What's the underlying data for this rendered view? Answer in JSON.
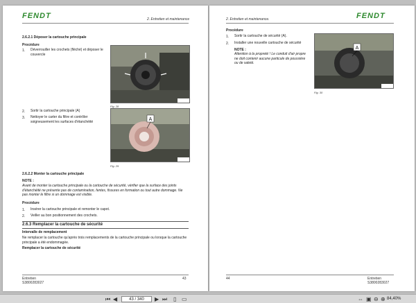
{
  "left_page": {
    "logo": "FENDT",
    "header": "2. Entretien et maintenance",
    "s1_title": "2.6.2.1  Déposer la cartouche principale",
    "procedure": "Procédure",
    "steps1": [
      {
        "n": "1.",
        "t": "Déverrouiller les crochets (fléché) et déposer le couvercle"
      },
      {
        "n": "2.",
        "t": "Sortir la cartouche principale (A)"
      },
      {
        "n": "3.",
        "t": "Nettoyer le carter du filtre et contrôler soigneusement les surfaces d'étanchéité"
      }
    ],
    "fig28": "Fig. 28",
    "fig29": "Fig. 29",
    "photo_label_a": "A",
    "s2_title": "2.6.2.2  Monter la cartouche principale",
    "note_label": "NOTE :",
    "note_text": "Avant de monter la cartouche principale ou la cartouche de sécurité, vérifier que la surface des joints d'étanchéité ne présente pas de contamination, fentes, fissures en formation ou tout autre dommage. Ne pas monter le filtre si un dommage est visible.",
    "procedure2": "Procédure",
    "steps2": [
      {
        "n": "1.",
        "t": "Insérer la cartouche principale et remonter le capot."
      },
      {
        "n": "2.",
        "t": "Veiller au bon positionnement des crochets."
      }
    ],
    "s3_title": "2.6.3  Remplacer la cartouche de sécurité",
    "interval_title": "Intervalle de remplacement",
    "interval_text": "Ne remplacer la cartouche qu'après trois remplacements de la cartouche principale ou lorsque la cartouche principale a été endommagée.",
    "replace_title": "Remplacer la cartouche de sécurité",
    "footer_left1": "Entretien",
    "footer_left2": "S3800283027",
    "page_number": "43"
  },
  "right_page": {
    "logo": "FENDT",
    "header": "2. Entretien et maintenance.",
    "procedure": "Procédure",
    "steps": [
      {
        "n": "1.",
        "t": "Sortir la cartouche de sécurité (A)."
      },
      {
        "n": "2.",
        "t": "Installer une nouvelle cartouche de sécurité"
      }
    ],
    "note_label": "NOTE :",
    "note_text": "Attention à la propreté ! Le conduit d'air propre ne doit contenir aucune particule de poussière ou de saleté.",
    "fig30": "Fig. 30",
    "photo_label_a": "A",
    "page_number": "44",
    "footer_right1": "Entretien",
    "footer_right2": "S3800283027"
  },
  "toolbar": {
    "page_indicator": "43 / 340",
    "zoom": "84,40%"
  },
  "colors": {
    "logo_green": "#2f8a2f",
    "background": "#bfbfbf"
  }
}
